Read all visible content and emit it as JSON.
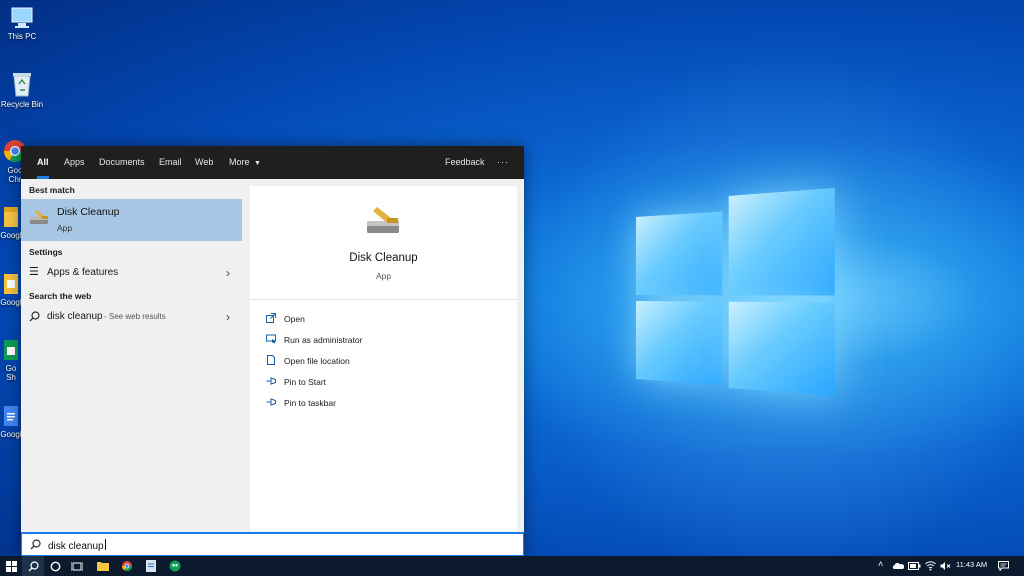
{
  "desktop": {
    "icons": [
      {
        "label": "This PC",
        "icon": "pc-icon"
      },
      {
        "label": "Recycle Bin",
        "icon": "recycle-bin-icon"
      },
      {
        "label": "Goo Chr",
        "icon": "chrome-icon"
      },
      {
        "label": "Googl",
        "icon": "google-folder-icon"
      },
      {
        "label": "Googl",
        "icon": "google-folder-icon"
      },
      {
        "label": "Go Sh",
        "icon": "google-sheets-icon"
      },
      {
        "label": "Googl",
        "icon": "google-docs-icon"
      }
    ]
  },
  "start_menu": {
    "tabs": [
      "All",
      "Apps",
      "Documents",
      "Email",
      "Web",
      "More"
    ],
    "feedback_label": "Feedback",
    "overflow_label": "···",
    "best_match_header": "Best match",
    "best_match": {
      "title": "Disk Cleanup",
      "subtitle": "App",
      "icon": "disk-cleanup-icon"
    },
    "settings_header": "Settings",
    "settings_item": "Apps & features",
    "web_header": "Search the web",
    "web_item": {
      "query": "disk cleanup",
      "suffix": "- See web results"
    },
    "preview": {
      "title": "Disk Cleanup",
      "subtitle": "App",
      "actions": [
        {
          "label": "Open",
          "icon": "open-icon"
        },
        {
          "label": "Run as administrator",
          "icon": "run-as-admin-icon"
        },
        {
          "label": "Open file location",
          "icon": "file-location-icon"
        },
        {
          "label": "Pin to Start",
          "icon": "pin-icon"
        },
        {
          "label": "Pin to taskbar",
          "icon": "pin-icon"
        }
      ]
    },
    "search_query": "disk cleanup"
  },
  "taskbar": {
    "clock": "11:43 AM",
    "accent": "#1b7ee6"
  }
}
